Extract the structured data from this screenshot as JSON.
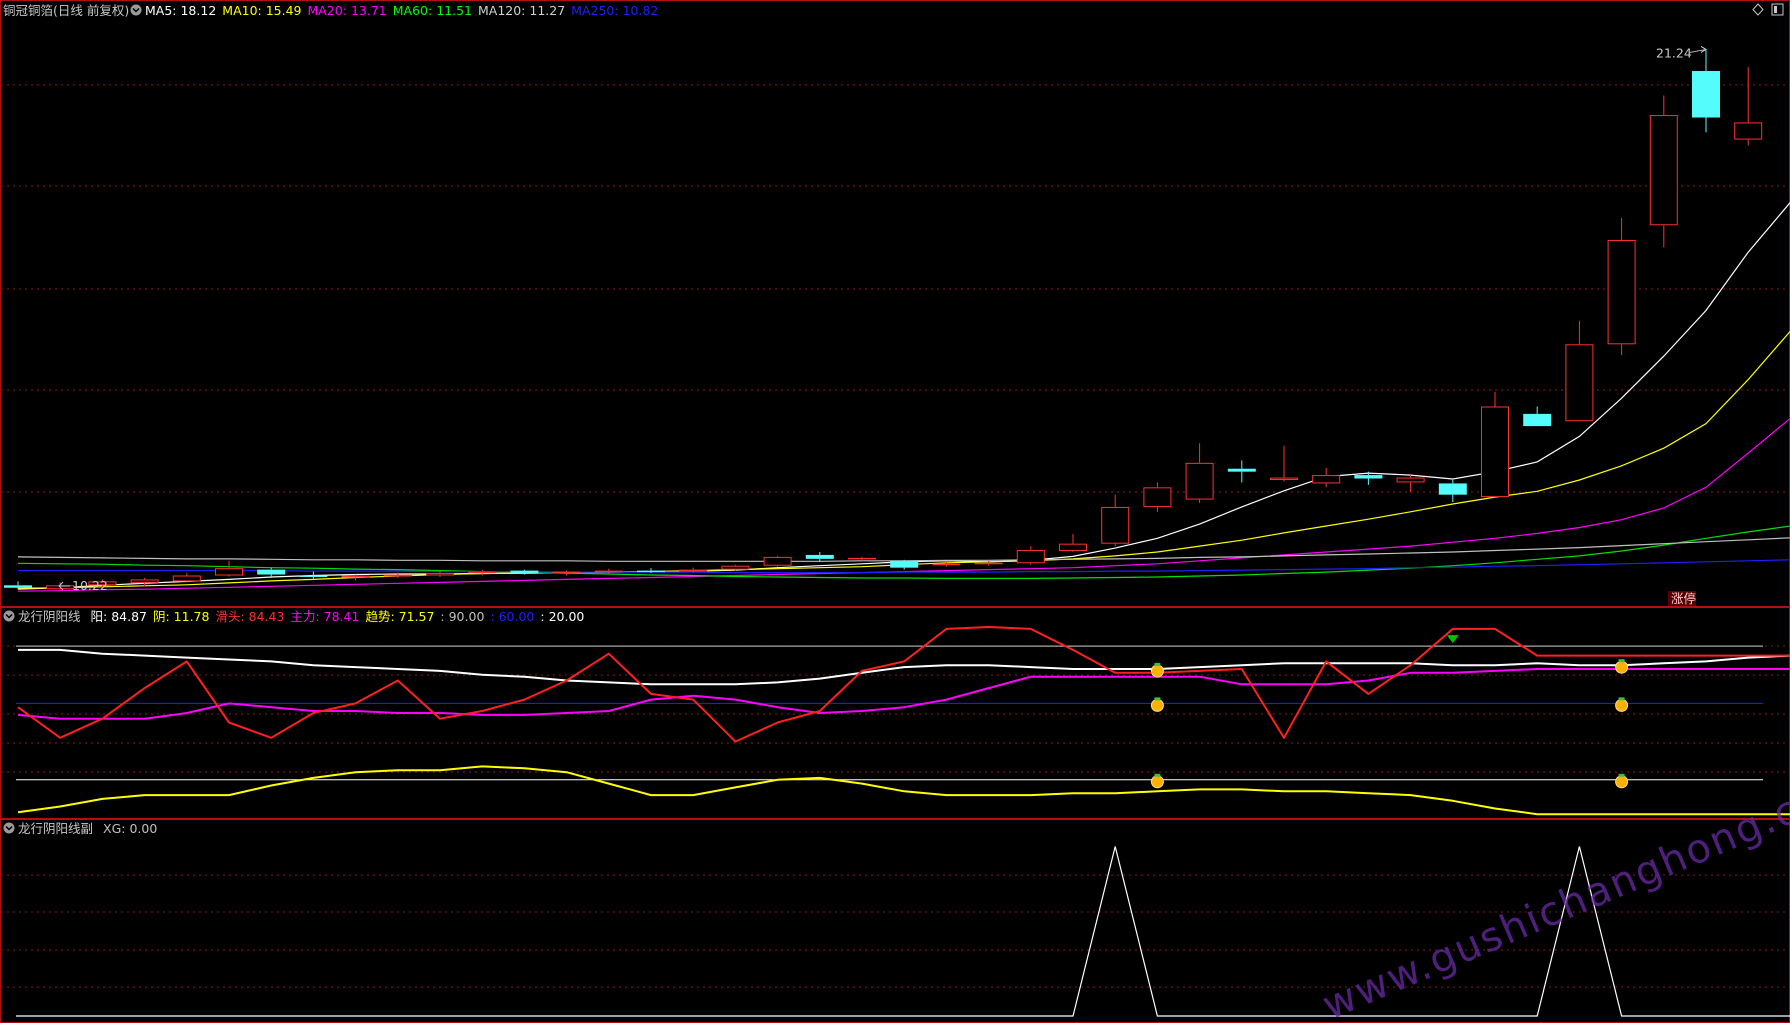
{
  "colors": {
    "background": "#000000",
    "border": "#b01010",
    "grid": "#8a1a1a",
    "up": "#ff3030",
    "down": "#54fcfc",
    "white": "#ffffff",
    "yellow": "#ffff00",
    "magenta": "#ff00ff",
    "green": "#00e000",
    "blue": "#2020ff",
    "gray": "#c0c0c0",
    "watermark": "#6a2aa6"
  },
  "main_panel": {
    "title": "铜冠铜箔(日线 前复权)",
    "indicators": [
      {
        "label": "MA5: ",
        "value": "18.12",
        "color": "#ffffff"
      },
      {
        "label": "MA10: ",
        "value": "15.49",
        "color": "#ffff00"
      },
      {
        "label": "MA20: ",
        "value": "13.71",
        "color": "#ff00ff"
      },
      {
        "label": "MA60: ",
        "value": "11.51",
        "color": "#00ff00"
      },
      {
        "label": "MA120: ",
        "value": "11.27",
        "color": "#d0d0d0"
      },
      {
        "label": "MA250: ",
        "value": "10.82",
        "color": "#2020ff"
      }
    ],
    "high_label": "21.24",
    "low_label": "10.22",
    "zhangting_label": "涨停"
  },
  "sub1": {
    "title": "龙行阴阳线",
    "items": [
      {
        "label": "阳: ",
        "value": "84.87",
        "color": "#ffffff"
      },
      {
        "label": "阴: ",
        "value": "11.78",
        "color": "#ffff00"
      },
      {
        "label": "滑头: ",
        "value": "84.43",
        "color": "#ff3030"
      },
      {
        "label": "主力: ",
        "value": "78.41",
        "color": "#ff00ff"
      },
      {
        "label": "趋势: ",
        "value": "71.57",
        "color": "#ffff00"
      },
      {
        "label": ": ",
        "value": "90.00",
        "color": "#c0c0c0"
      },
      {
        "label": ": ",
        "value": "60.00",
        "color": "#2020ff"
      },
      {
        "label": ": ",
        "value": "20.00",
        "color": "#ffffff"
      }
    ]
  },
  "sub2": {
    "title": "龙行阴阳线副",
    "items": [
      {
        "label": "XG: ",
        "value": "0.00",
        "color": "#c0c0c0"
      }
    ]
  },
  "watermark": "www.gushichanghong.com",
  "chart_data": {
    "type": "candlestick",
    "candles": [
      {
        "o": 10.3,
        "h": 10.38,
        "l": 10.22,
        "c": 10.25,
        "dir": "down"
      },
      {
        "o": 10.22,
        "h": 10.36,
        "l": 10.2,
        "c": 10.3,
        "dir": "up"
      },
      {
        "o": 10.3,
        "h": 10.42,
        "l": 10.26,
        "c": 10.38,
        "dir": "up"
      },
      {
        "o": 10.35,
        "h": 10.45,
        "l": 10.28,
        "c": 10.42,
        "dir": "up"
      },
      {
        "o": 10.38,
        "h": 10.55,
        "l": 10.36,
        "c": 10.5,
        "dir": "up"
      },
      {
        "o": 10.5,
        "h": 10.8,
        "l": 10.48,
        "c": 10.65,
        "dir": "up"
      },
      {
        "o": 10.62,
        "h": 10.66,
        "l": 10.45,
        "c": 10.52,
        "dir": "down"
      },
      {
        "o": 10.5,
        "h": 10.58,
        "l": 10.44,
        "c": 10.48,
        "dir": "down"
      },
      {
        "o": 10.46,
        "h": 10.52,
        "l": 10.4,
        "c": 10.5,
        "dir": "up"
      },
      {
        "o": 10.48,
        "h": 10.56,
        "l": 10.45,
        "c": 10.52,
        "dir": "up"
      },
      {
        "o": 10.5,
        "h": 10.6,
        "l": 10.47,
        "c": 10.55,
        "dir": "up"
      },
      {
        "o": 10.55,
        "h": 10.62,
        "l": 10.5,
        "c": 10.58,
        "dir": "up"
      },
      {
        "o": 10.6,
        "h": 10.62,
        "l": 10.52,
        "c": 10.55,
        "dir": "down"
      },
      {
        "o": 10.55,
        "h": 10.6,
        "l": 10.5,
        "c": 10.58,
        "dir": "up"
      },
      {
        "o": 10.58,
        "h": 10.64,
        "l": 10.54,
        "c": 10.6,
        "dir": "up"
      },
      {
        "o": 10.6,
        "h": 10.65,
        "l": 10.55,
        "c": 10.6,
        "dir": "down"
      },
      {
        "o": 10.58,
        "h": 10.66,
        "l": 10.56,
        "c": 10.62,
        "dir": "up"
      },
      {
        "o": 10.62,
        "h": 10.72,
        "l": 10.6,
        "c": 10.7,
        "dir": "up"
      },
      {
        "o": 10.7,
        "h": 10.9,
        "l": 10.68,
        "c": 10.88,
        "dir": "up"
      },
      {
        "o": 10.92,
        "h": 10.98,
        "l": 10.78,
        "c": 10.84,
        "dir": "down"
      },
      {
        "o": 10.84,
        "h": 10.88,
        "l": 10.8,
        "c": 10.86,
        "dir": "up"
      },
      {
        "o": 10.8,
        "h": 10.82,
        "l": 10.62,
        "c": 10.66,
        "dir": "down"
      },
      {
        "o": 10.72,
        "h": 10.78,
        "l": 10.68,
        "c": 10.74,
        "dir": "up"
      },
      {
        "o": 10.74,
        "h": 10.8,
        "l": 10.7,
        "c": 10.76,
        "dir": "up"
      },
      {
        "o": 10.75,
        "h": 11.1,
        "l": 10.72,
        "c": 11.02,
        "dir": "up"
      },
      {
        "o": 11.0,
        "h": 11.35,
        "l": 10.98,
        "c": 11.15,
        "dir": "up"
      },
      {
        "o": 11.15,
        "h": 12.15,
        "l": 11.1,
        "c": 11.9,
        "dir": "up"
      },
      {
        "o": 11.9,
        "h": 12.4,
        "l": 11.8,
        "c": 12.3,
        "dir": "up"
      },
      {
        "o": 12.05,
        "h": 13.2,
        "l": 11.98,
        "c": 12.8,
        "dir": "up"
      },
      {
        "o": 12.68,
        "h": 12.85,
        "l": 12.4,
        "c": 12.62,
        "dir": "down"
      },
      {
        "o": 12.45,
        "h": 13.15,
        "l": 12.42,
        "c": 12.5,
        "dir": "up"
      },
      {
        "o": 12.38,
        "h": 12.7,
        "l": 12.3,
        "c": 12.55,
        "dir": "up"
      },
      {
        "o": 12.55,
        "h": 12.62,
        "l": 12.35,
        "c": 12.48,
        "dir": "down"
      },
      {
        "o": 12.4,
        "h": 12.55,
        "l": 12.2,
        "c": 12.5,
        "dir": "up"
      },
      {
        "o": 12.38,
        "h": 12.45,
        "l": 12.0,
        "c": 12.15,
        "dir": "down"
      },
      {
        "o": 12.1,
        "h": 14.25,
        "l": 12.08,
        "c": 13.95,
        "dir": "up"
      },
      {
        "o": 13.8,
        "h": 13.95,
        "l": 13.55,
        "c": 13.55,
        "dir": "down"
      },
      {
        "o": 13.65,
        "h": 15.7,
        "l": 13.65,
        "c": 15.22,
        "dir": "up"
      },
      {
        "o": 15.22,
        "h": 17.8,
        "l": 15.0,
        "c": 17.35,
        "dir": "up"
      },
      {
        "o": 17.65,
        "h": 20.3,
        "l": 17.2,
        "c": 19.9,
        "dir": "up"
      },
      {
        "o": 20.8,
        "h": 21.24,
        "l": 19.55,
        "c": 19.85,
        "dir": "down"
      },
      {
        "o": 19.75,
        "h": 20.88,
        "l": 19.28,
        "c": 19.4,
        "dir": "up"
      }
    ],
    "ma": [
      {
        "name": "MA5",
        "values": [
          10.22,
          10.25,
          10.3,
          10.34,
          10.38,
          10.42,
          10.47,
          10.5,
          10.52,
          10.53,
          10.53,
          10.54,
          10.55,
          10.56,
          10.57,
          10.58,
          10.59,
          10.61,
          10.66,
          10.7,
          10.74,
          10.78,
          10.8,
          10.78,
          10.81,
          10.89,
          11.06,
          11.26,
          11.55,
          11.9,
          12.23,
          12.52,
          12.59,
          12.55,
          12.47,
          12.62,
          12.82,
          13.34,
          14.12,
          14.98,
          15.91,
          17.1,
          18.12
        ]
      },
      {
        "name": "MA10",
        "values": [
          10.24,
          10.25,
          10.27,
          10.29,
          10.31,
          10.35,
          10.39,
          10.42,
          10.46,
          10.49,
          10.52,
          10.54,
          10.55,
          10.56,
          10.57,
          10.58,
          10.6,
          10.62,
          10.64,
          10.66,
          10.68,
          10.72,
          10.76,
          10.78,
          10.8,
          10.84,
          10.9,
          10.98,
          11.1,
          11.22,
          11.37,
          11.51,
          11.65,
          11.8,
          11.96,
          12.1,
          12.22,
          12.45,
          12.74,
          13.1,
          13.6,
          14.5,
          15.49
        ]
      },
      {
        "name": "MA20",
        "values": [
          10.18,
          10.19,
          10.21,
          10.22,
          10.24,
          10.26,
          10.28,
          10.3,
          10.32,
          10.34,
          10.36,
          10.38,
          10.4,
          10.42,
          10.44,
          10.46,
          10.48,
          10.5,
          10.52,
          10.54,
          10.56,
          10.58,
          10.6,
          10.62,
          10.64,
          10.66,
          10.7,
          10.74,
          10.8,
          10.86,
          10.92,
          10.98,
          11.04,
          11.1,
          11.18,
          11.26,
          11.36,
          11.48,
          11.64,
          11.88,
          12.3,
          13.0,
          13.71
        ]
      },
      {
        "name": "MA60",
        "values": [
          10.75,
          10.74,
          10.73,
          10.71,
          10.7,
          10.68,
          10.66,
          10.65,
          10.63,
          10.62,
          10.6,
          10.58,
          10.57,
          10.55,
          10.53,
          10.51,
          10.5,
          10.48,
          10.47,
          10.46,
          10.45,
          10.45,
          10.44,
          10.44,
          10.44,
          10.45,
          10.46,
          10.47,
          10.49,
          10.51,
          10.54,
          10.57,
          10.61,
          10.65,
          10.7,
          10.76,
          10.83,
          10.9,
          11.0,
          11.12,
          11.26,
          11.39,
          11.51
        ]
      },
      {
        "name": "MA120",
        "values": [
          10.88,
          10.87,
          10.86,
          10.85,
          10.84,
          10.84,
          10.83,
          10.82,
          10.82,
          10.81,
          10.81,
          10.8,
          10.8,
          10.8,
          10.79,
          10.79,
          10.79,
          10.79,
          10.79,
          10.79,
          10.8,
          10.8,
          10.81,
          10.81,
          10.82,
          10.83,
          10.84,
          10.85,
          10.87,
          10.88,
          10.9,
          10.92,
          10.94,
          10.96,
          10.98,
          11.01,
          11.04,
          11.07,
          11.11,
          11.15,
          11.19,
          11.23,
          11.27
        ]
      },
      {
        "name": "MA250",
        "values": [
          10.6,
          10.6,
          10.6,
          10.6,
          10.6,
          10.6,
          10.6,
          10.59,
          10.59,
          10.59,
          10.58,
          10.58,
          10.58,
          10.57,
          10.57,
          10.57,
          10.57,
          10.56,
          10.56,
          10.56,
          10.56,
          10.57,
          10.57,
          10.57,
          10.58,
          10.58,
          10.59,
          10.59,
          10.6,
          10.61,
          10.62,
          10.63,
          10.64,
          10.66,
          10.67,
          10.69,
          10.7,
          10.72,
          10.74,
          10.76,
          10.78,
          10.8,
          10.82
        ]
      }
    ],
    "y_range": [
      10.0,
      21.8
    ],
    "sub1_range": [
      0,
      100
    ],
    "sub1_series": {
      "yang": {
        "name": "阳",
        "values": [
          88,
          88,
          86,
          85,
          84,
          83,
          82,
          80,
          79,
          78,
          77,
          75,
          74,
          72,
          71,
          70,
          70,
          70,
          71,
          73,
          76,
          79,
          80,
          80,
          79,
          78,
          78,
          78,
          79,
          80,
          81,
          81,
          81,
          81,
          80,
          80,
          81,
          80,
          80,
          81,
          82,
          84,
          85
        ]
      },
      "huatou": {
        "name": "滑头",
        "values": [
          58,
          42,
          52,
          68,
          82,
          50,
          42,
          55,
          60,
          72,
          52,
          56,
          62,
          72,
          86,
          65,
          62,
          40,
          50,
          56,
          77,
          82,
          99,
          100,
          99,
          88,
          76,
          76,
          77,
          78,
          42,
          82,
          65,
          80,
          99,
          99,
          85,
          85,
          85,
          85,
          85,
          85,
          85
        ]
      },
      "zhuli": {
        "name": "主力",
        "values": [
          54,
          52,
          52,
          52,
          55,
          60,
          58,
          56,
          56,
          55,
          55,
          54,
          54,
          55,
          56,
          62,
          64,
          62,
          58,
          55,
          56,
          58,
          62,
          68,
          74,
          74,
          74,
          74,
          74,
          70,
          70,
          70,
          72,
          76,
          76,
          77,
          78,
          78,
          78,
          78,
          78,
          78,
          78
        ]
      },
      "qushi": {
        "name": "趋势",
        "values": [
          3,
          6,
          10,
          12,
          12,
          12,
          17,
          21,
          24,
          25,
          25,
          27,
          26,
          24,
          18,
          12,
          12,
          16,
          20,
          21,
          18,
          14,
          12,
          12,
          12,
          13,
          13,
          14,
          15,
          15,
          14,
          14,
          13,
          12,
          9,
          5,
          2,
          2,
          2,
          2,
          2,
          2,
          2
        ]
      },
      "levels": [
        90,
        60,
        20
      ]
    },
    "sub1_signals": [
      27,
      38
    ],
    "sub1_arrow_index": 34,
    "sub2_series": {
      "name": "XG",
      "values": [
        0,
        0,
        0,
        0,
        0,
        0,
        0,
        0,
        0,
        0,
        0,
        0,
        0,
        0,
        0,
        0,
        0,
        0,
        0,
        0,
        0,
        0,
        0,
        0,
        0,
        0,
        1,
        0,
        0,
        0,
        0,
        0,
        0,
        0,
        0,
        0,
        0,
        1,
        0,
        0,
        0,
        0,
        0
      ]
    },
    "sub2_range": [
      0,
      1.05
    ]
  }
}
